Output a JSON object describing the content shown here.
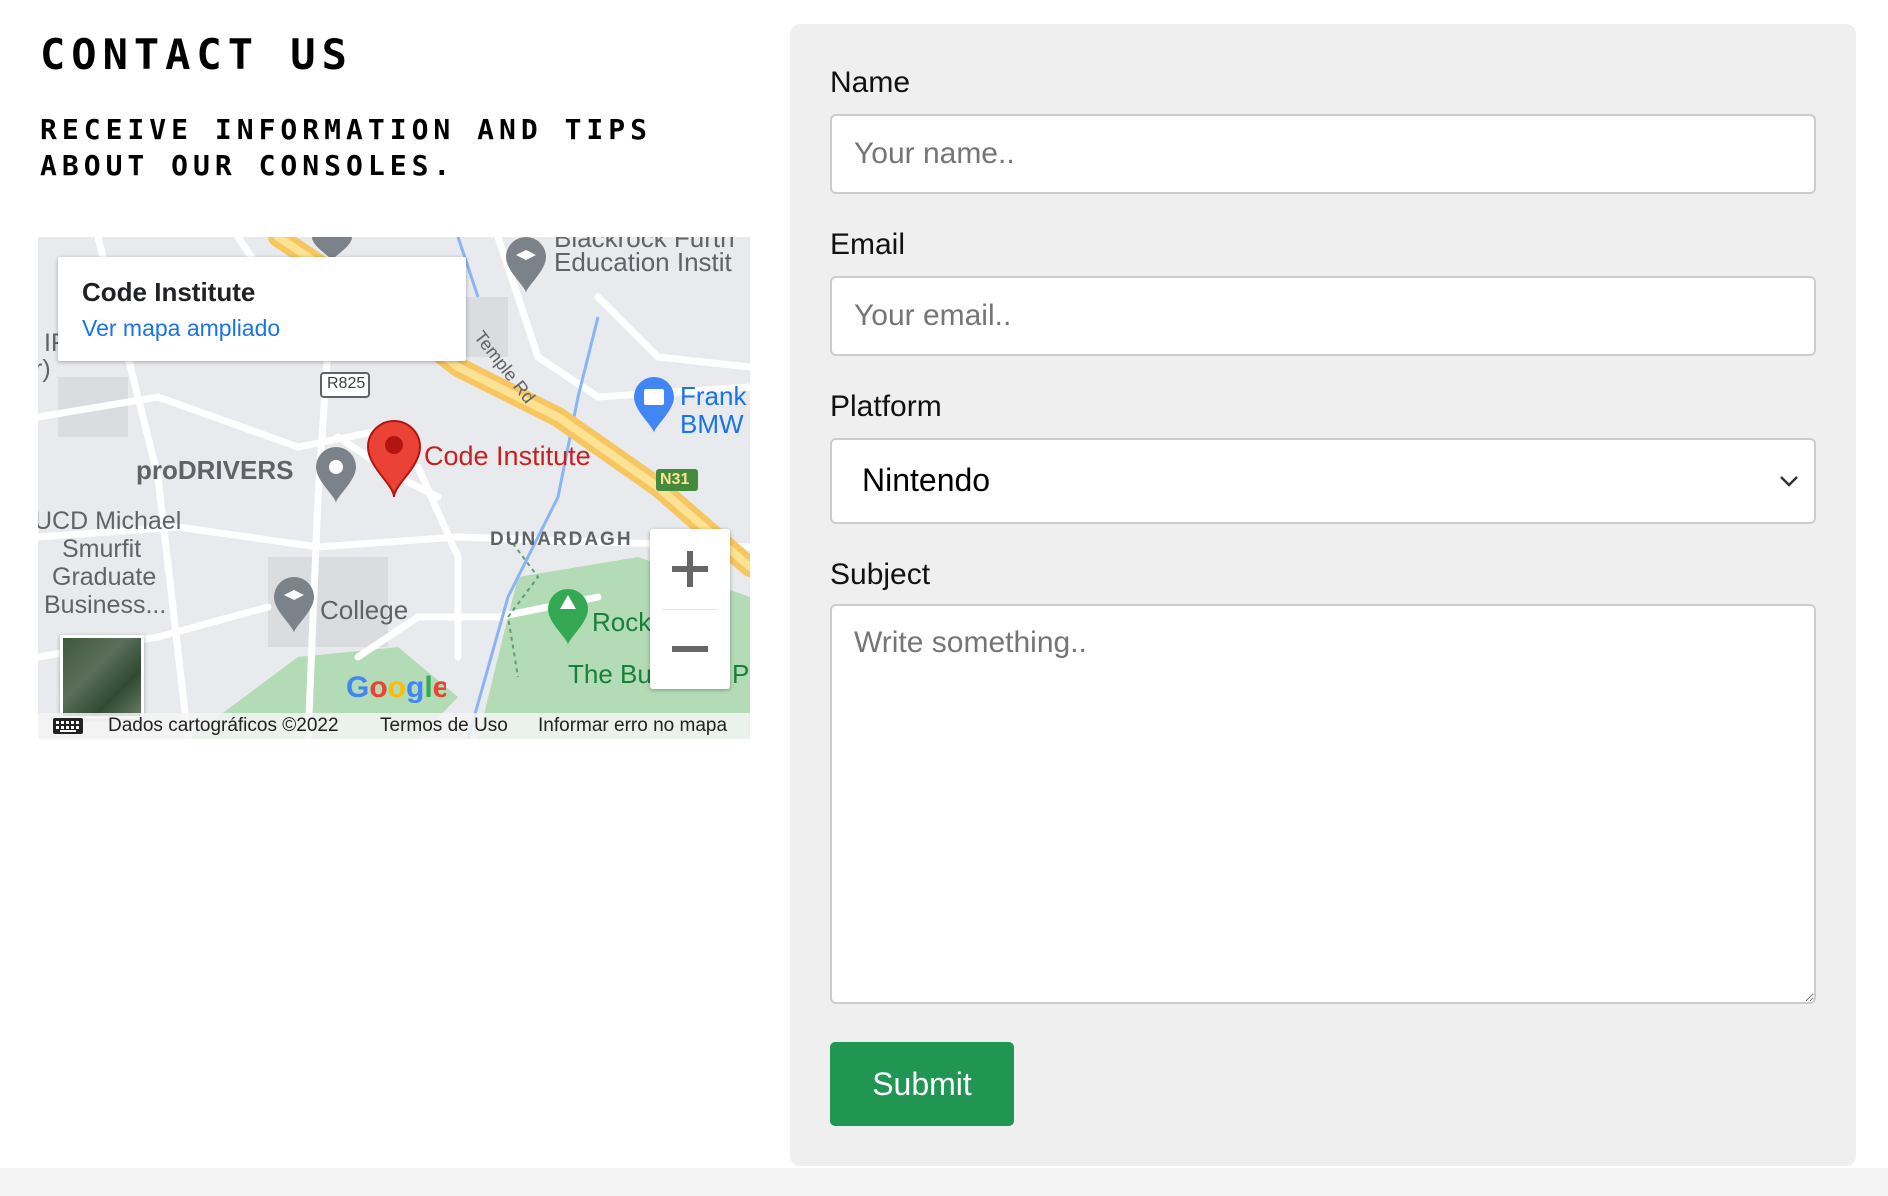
{
  "header": {
    "title": "CONTACT US",
    "subtitle": "RECEIVE INFORMATION AND TIPS ABOUT OUR CONSOLES."
  },
  "map": {
    "place_name": "Code Institute",
    "enlarge_link": "Ver mapa ampliado",
    "labels": {
      "education": "Education Instit",
      "blackrock": "Blackrock Furth",
      "temple_rd": "Temple Rd",
      "r825": "R825",
      "frank": "Frank",
      "bmw": "BMW",
      "prodrivers": "proDRIVERS",
      "code_institute": "Code Institute",
      "n31": "N31",
      "ucd_line1": "UCD Michael",
      "ucd_line2": "Smurfit",
      "ucd_line3": "Graduate",
      "ucd_line4": "Business...",
      "dunardagh": "DUNARDAGH",
      "college": "College",
      "rock": "Rock",
      "the_bu": "The Bu",
      "pa": "Pa",
      "left_edge_1": "IF",
      "left_edge_2": "r)"
    },
    "google_logo": "Google",
    "attribution": {
      "data": "Dados cartográficos ©2022",
      "terms": "Termos de Uso",
      "report": "Informar erro no mapa"
    },
    "colors": {
      "pin": "#ea4335",
      "link": "#1a73e8",
      "highway": "#f6c760",
      "park": "#b3dbb5"
    }
  },
  "form": {
    "name_label": "Name",
    "name_placeholder": "Your name..",
    "email_label": "Email",
    "email_placeholder": "Your email..",
    "platform_label": "Platform",
    "platform_selected": "Nintendo",
    "subject_label": "Subject",
    "subject_placeholder": "Write something..",
    "submit_label": "Submit",
    "submit_color": "#219653"
  }
}
